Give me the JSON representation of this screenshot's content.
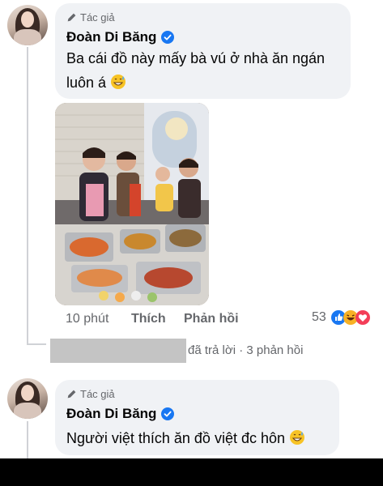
{
  "comment1": {
    "author_tag": "Tác giả",
    "author_name": "Đoàn Di Băng",
    "line1": "Ba cái đồ này mấy bà vú ở nhà ăn ngán",
    "line2": "luôn á",
    "time": "10 phút",
    "like_label": "Thích",
    "reply_label": "Phản hồi",
    "reaction_count": "53",
    "reactions": [
      "like-icon",
      "haha-icon",
      "love-icon"
    ]
  },
  "replies_summary": {
    "replied_text": "đã trả lời",
    "separator": "·",
    "replies_count_text": "3 phản hồi"
  },
  "comment2": {
    "author_tag": "Tác giả",
    "author_name": "Đoàn Di Băng",
    "text": "Người việt thích ăn đồ việt đc hôn"
  },
  "colors": {
    "bubble": "#f0f2f5",
    "verified": "#1877f2",
    "secondary_text": "#65676b",
    "like_blue": "#1877f2",
    "love_red": "#f33e58",
    "haha_yellow": "#f7b125"
  }
}
